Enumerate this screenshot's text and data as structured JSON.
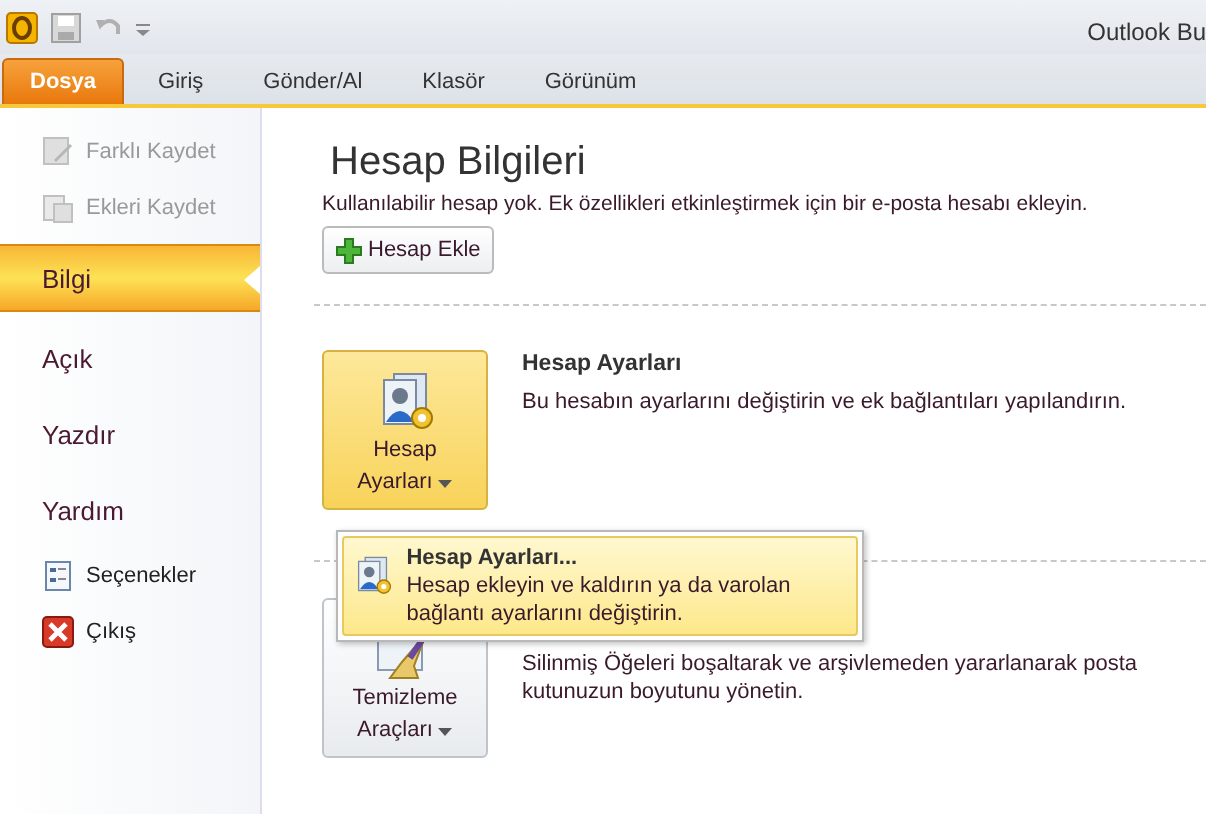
{
  "window": {
    "title": "Outlook Bu"
  },
  "tabs": [
    {
      "label": "Dosya",
      "selected": true
    },
    {
      "label": "Giriş",
      "selected": false
    },
    {
      "label": "Gönder/Al",
      "selected": false
    },
    {
      "label": "Klasör",
      "selected": false
    },
    {
      "label": "Görünüm",
      "selected": false
    }
  ],
  "sidebar": {
    "items": [
      {
        "kind": "command",
        "label": "Farklı Kaydet",
        "disabled": true
      },
      {
        "kind": "command",
        "label": "Ekleri Kaydet",
        "disabled": true
      },
      {
        "kind": "page",
        "label": "Bilgi",
        "disabled": false,
        "selected": true
      },
      {
        "kind": "page",
        "label": "Açık",
        "disabled": false,
        "selected": false
      },
      {
        "kind": "page",
        "label": "Yazdır",
        "disabled": false,
        "selected": false
      },
      {
        "kind": "page",
        "label": "Yardım",
        "disabled": false,
        "selected": false
      },
      {
        "kind": "command",
        "label": "Seçenekler",
        "disabled": false
      },
      {
        "kind": "command",
        "label": "Çıkış",
        "disabled": false
      }
    ]
  },
  "main": {
    "title": "Hesap Bilgileri",
    "subtitle": "Kullanılabilir hesap yok. Ek özellikleri etkinleştirmek için bir e-posta hesabı ekleyin.",
    "add_button": "Hesap Ekle",
    "sections": [
      {
        "button_lines": [
          "Hesap",
          "Ayarları"
        ],
        "hovered": true,
        "heading": "Hesap Ayarları",
        "description": "Bu hesabın ayarlarını değiştirin ve ek bağlantıları yapılandırın."
      },
      {
        "button_lines": [
          "Temizleme",
          "Araçları"
        ],
        "hovered": false,
        "description": "Silinmiş Öğeleri boşaltarak ve arşivlemeden yararlanarak posta kutunuzun boyutunu yönetin."
      }
    ],
    "menu": {
      "title": "Hesap Ayarları...",
      "description": "Hesap ekleyin ve kaldırın ya da varolan bağlantı ayarlarını değiştirin."
    }
  }
}
